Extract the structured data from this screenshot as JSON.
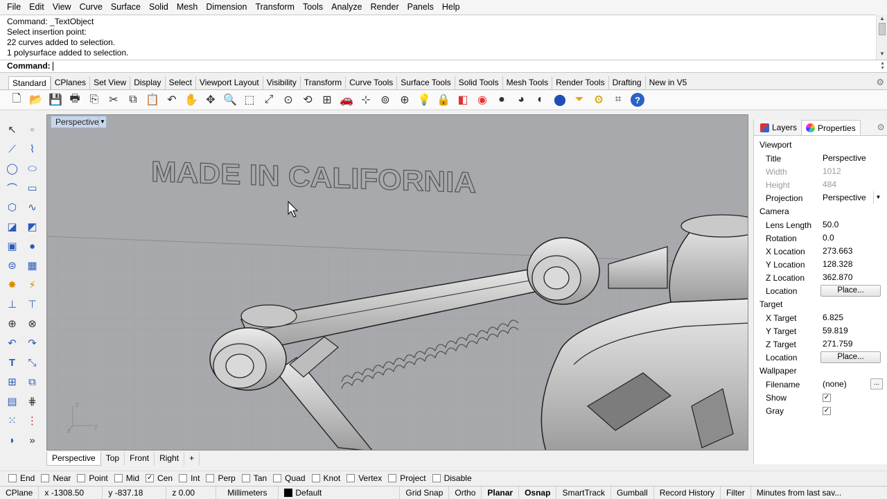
{
  "menu": [
    "File",
    "Edit",
    "View",
    "Curve",
    "Surface",
    "Solid",
    "Mesh",
    "Dimension",
    "Transform",
    "Tools",
    "Analyze",
    "Render",
    "Panels",
    "Help"
  ],
  "command_history": [
    "Command: _TextObject",
    "Select insertion point:",
    "22 curves added to selection.",
    "1 polysurface added to selection."
  ],
  "command_prompt": "Command:",
  "toolbar_tabs": [
    "Standard",
    "CPlanes",
    "Set View",
    "Display",
    "Select",
    "Viewport Layout",
    "Visibility",
    "Transform",
    "Curve Tools",
    "Surface Tools",
    "Solid Tools",
    "Mesh Tools",
    "Render Tools",
    "Drafting",
    "New in V5"
  ],
  "toolbar_tabs_active": "Standard",
  "toolbar_icons": [
    "new-icon",
    "open-icon",
    "save-icon",
    "print-icon",
    "import-icon",
    "cut-icon",
    "copy-icon",
    "paste-icon",
    "undo-icon",
    "pan-icon",
    "move-icon",
    "zoom-icon",
    "zoom-window-icon",
    "zoom-extents-icon",
    "zoom-selected-icon",
    "rotate-view-icon",
    "four-viewports-icon",
    "car-icon",
    "cplane-icon",
    "osnap-icon",
    "point-icon",
    "light-icon",
    "lock-icon",
    "layer-icon",
    "color-wheel-icon",
    "shaded-icon",
    "rendered-icon",
    "ghosted-icon",
    "render-icon",
    "filter-icon",
    "options-icon",
    "properties-icon",
    "help-icon"
  ],
  "viewport": {
    "title": "Perspective",
    "text_object": "MADE IN CALIFORNIA",
    "axis_labels": {
      "z": "z",
      "y": "y",
      "x": "x"
    },
    "tabs": [
      "Perspective",
      "Top",
      "Front",
      "Right"
    ],
    "active_tab": "Perspective",
    "add_tab": "+"
  },
  "panel": {
    "tabs": [
      "Layers",
      "Properties"
    ],
    "active_tab": "Properties",
    "sections": {
      "viewport": "Viewport",
      "camera": "Camera",
      "target": "Target",
      "wallpaper": "Wallpaper"
    },
    "viewport_rows": [
      {
        "k": "Title",
        "v": "Perspective",
        "dim": false
      },
      {
        "k": "Width",
        "v": "1012",
        "dim": true
      },
      {
        "k": "Height",
        "v": "484",
        "dim": true
      },
      {
        "k": "Projection",
        "v": "Perspective",
        "dim": false
      }
    ],
    "camera_rows": [
      {
        "k": "Lens Length",
        "v": "50.0"
      },
      {
        "k": "Rotation",
        "v": "0.0"
      },
      {
        "k": "X Location",
        "v": "273.663"
      },
      {
        "k": "Y Location",
        "v": "128.328"
      },
      {
        "k": "Z Location",
        "v": "362.870"
      },
      {
        "k": "Location",
        "btn": "Place..."
      }
    ],
    "target_rows": [
      {
        "k": "X Target",
        "v": "6.825"
      },
      {
        "k": "Y Target",
        "v": "59.819"
      },
      {
        "k": "Z Target",
        "v": "271.759"
      },
      {
        "k": "Location",
        "btn": "Place..."
      }
    ],
    "wallpaper_rows": [
      {
        "k": "Filename",
        "v": "(none)"
      },
      {
        "k": "Show",
        "checked": true
      },
      {
        "k": "Gray",
        "checked": true
      }
    ],
    "more_button": "..."
  },
  "osnap": [
    {
      "label": "End",
      "checked": false
    },
    {
      "label": "Near",
      "checked": false
    },
    {
      "label": "Point",
      "checked": false
    },
    {
      "label": "Mid",
      "checked": false
    },
    {
      "label": "Cen",
      "checked": true
    },
    {
      "label": "Int",
      "checked": false
    },
    {
      "label": "Perp",
      "checked": false
    },
    {
      "label": "Tan",
      "checked": false
    },
    {
      "label": "Quad",
      "checked": false
    },
    {
      "label": "Knot",
      "checked": false
    },
    {
      "label": "Vertex",
      "checked": false
    },
    {
      "label": "Project",
      "checked": false
    },
    {
      "label": "Disable",
      "checked": false
    }
  ],
  "status": {
    "cplane": "CPlane",
    "x": "x -1308.50",
    "y": "y -837.18",
    "z": "z 0.00",
    "units": "Millimeters",
    "layer": "Default",
    "toggles": [
      {
        "label": "Grid Snap",
        "bold": false
      },
      {
        "label": "Ortho",
        "bold": false
      },
      {
        "label": "Planar",
        "bold": true
      },
      {
        "label": "Osnap",
        "bold": true
      },
      {
        "label": "SmartTrack",
        "bold": false
      },
      {
        "label": "Gumball",
        "bold": false
      },
      {
        "label": "Record History",
        "bold": false
      },
      {
        "label": "Filter",
        "bold": false
      }
    ],
    "message": "Minutes from last sav..."
  }
}
